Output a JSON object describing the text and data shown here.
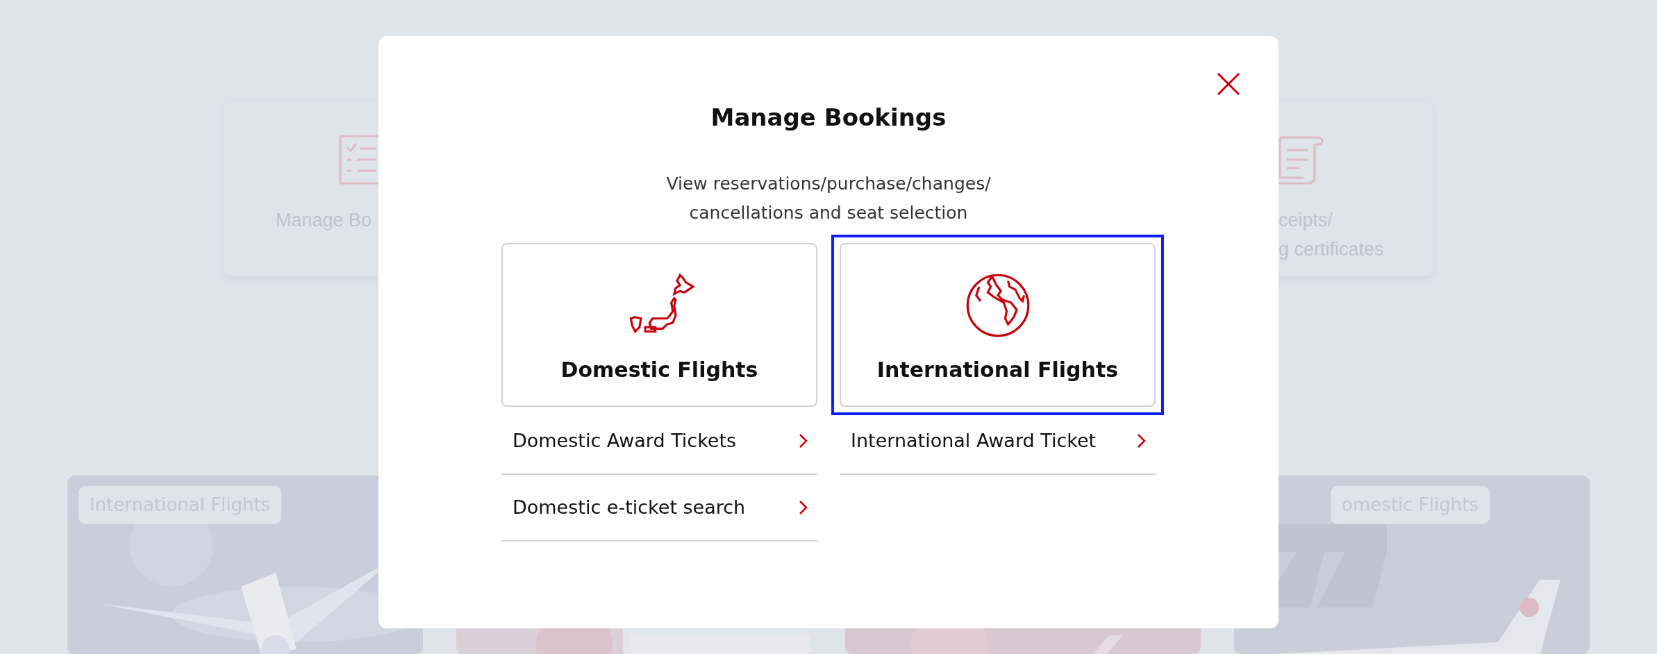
{
  "background_cards": [
    {
      "kind": "checklist",
      "lines": [
        "Manage Bo"
      ]
    },
    {
      "kind": "receipt",
      "lines": [
        "ceipts/",
        "g certificates"
      ]
    }
  ],
  "promo_tiles": [
    {
      "kind": "picture",
      "tag": "International Flights"
    },
    {
      "kind": "picture"
    },
    {
      "kind": "picture"
    },
    {
      "kind": "picture",
      "tag": "omestic Flights"
    }
  ],
  "modal": {
    "title": "Manage Bookings",
    "subtitle": [
      "View reservations/purchase/changes/",
      "cancellations and seat selection"
    ],
    "options": [
      {
        "kind": "domestic",
        "label": "Domestic Flights",
        "selected": false,
        "links": [
          "Domestic Award Tickets",
          "Domestic e-ticket search"
        ]
      },
      {
        "kind": "international",
        "label": "International Flights",
        "selected": true,
        "links": [
          "International Award Ticket"
        ]
      }
    ]
  }
}
